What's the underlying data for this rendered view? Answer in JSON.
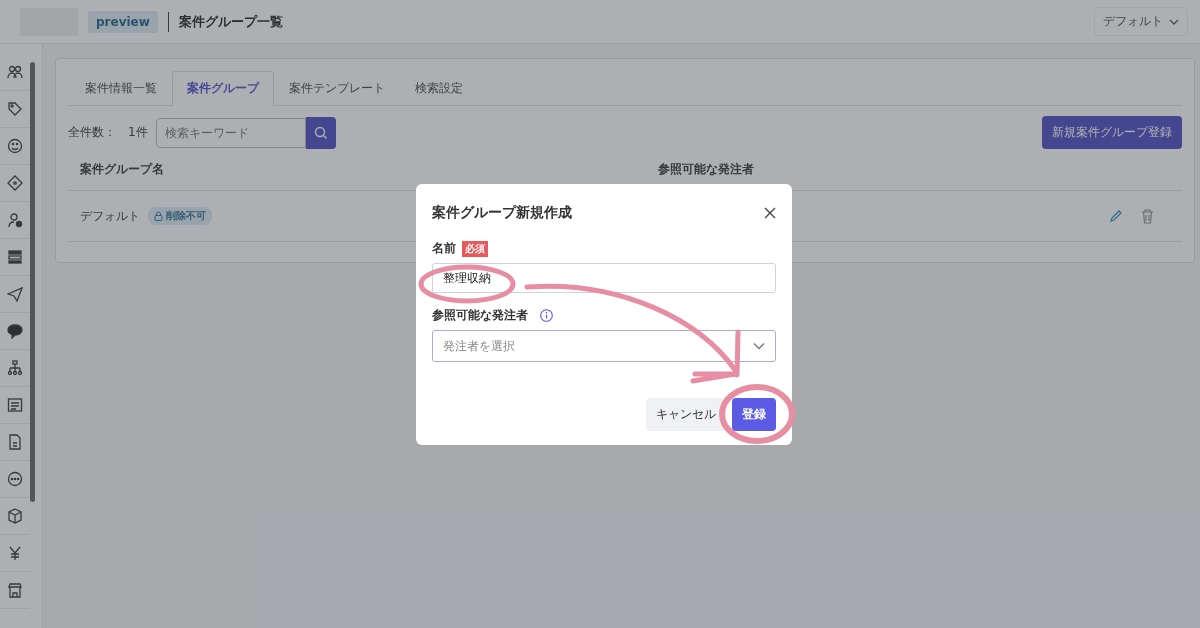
{
  "header": {
    "badge": "preview",
    "title": "案件グループ一覧",
    "account_menu": "デフォルト"
  },
  "tabs": [
    {
      "label": "案件情報一覧",
      "selected": false
    },
    {
      "label": "案件グループ",
      "selected": true
    },
    {
      "label": "案件テンプレート",
      "selected": false
    },
    {
      "label": "検索設定",
      "selected": false
    }
  ],
  "toolbar": {
    "count_label": "全件数：",
    "count": "1件",
    "search": {
      "placeholder": "検索キーワード"
    },
    "new_button": "新規案件グループ登録"
  },
  "table": {
    "columns": [
      "案件グループ名",
      "参照可能な発注者"
    ],
    "rows": [
      {
        "name": "デフォルト",
        "tag": "削除不可"
      }
    ]
  },
  "dialog": {
    "title": "案件グループ新規作成",
    "fields": [
      {
        "kind": "text",
        "label": "名前",
        "required_badge": "必須",
        "value": "整理収納"
      },
      {
        "kind": "select",
        "label": "参照可能な発注者",
        "info": true,
        "placeholder": "発注者を選択"
      }
    ],
    "buttons": [
      {
        "kind": "secondary",
        "label": "キャンセル"
      },
      {
        "kind": "primary",
        "label": "登録"
      }
    ]
  }
}
